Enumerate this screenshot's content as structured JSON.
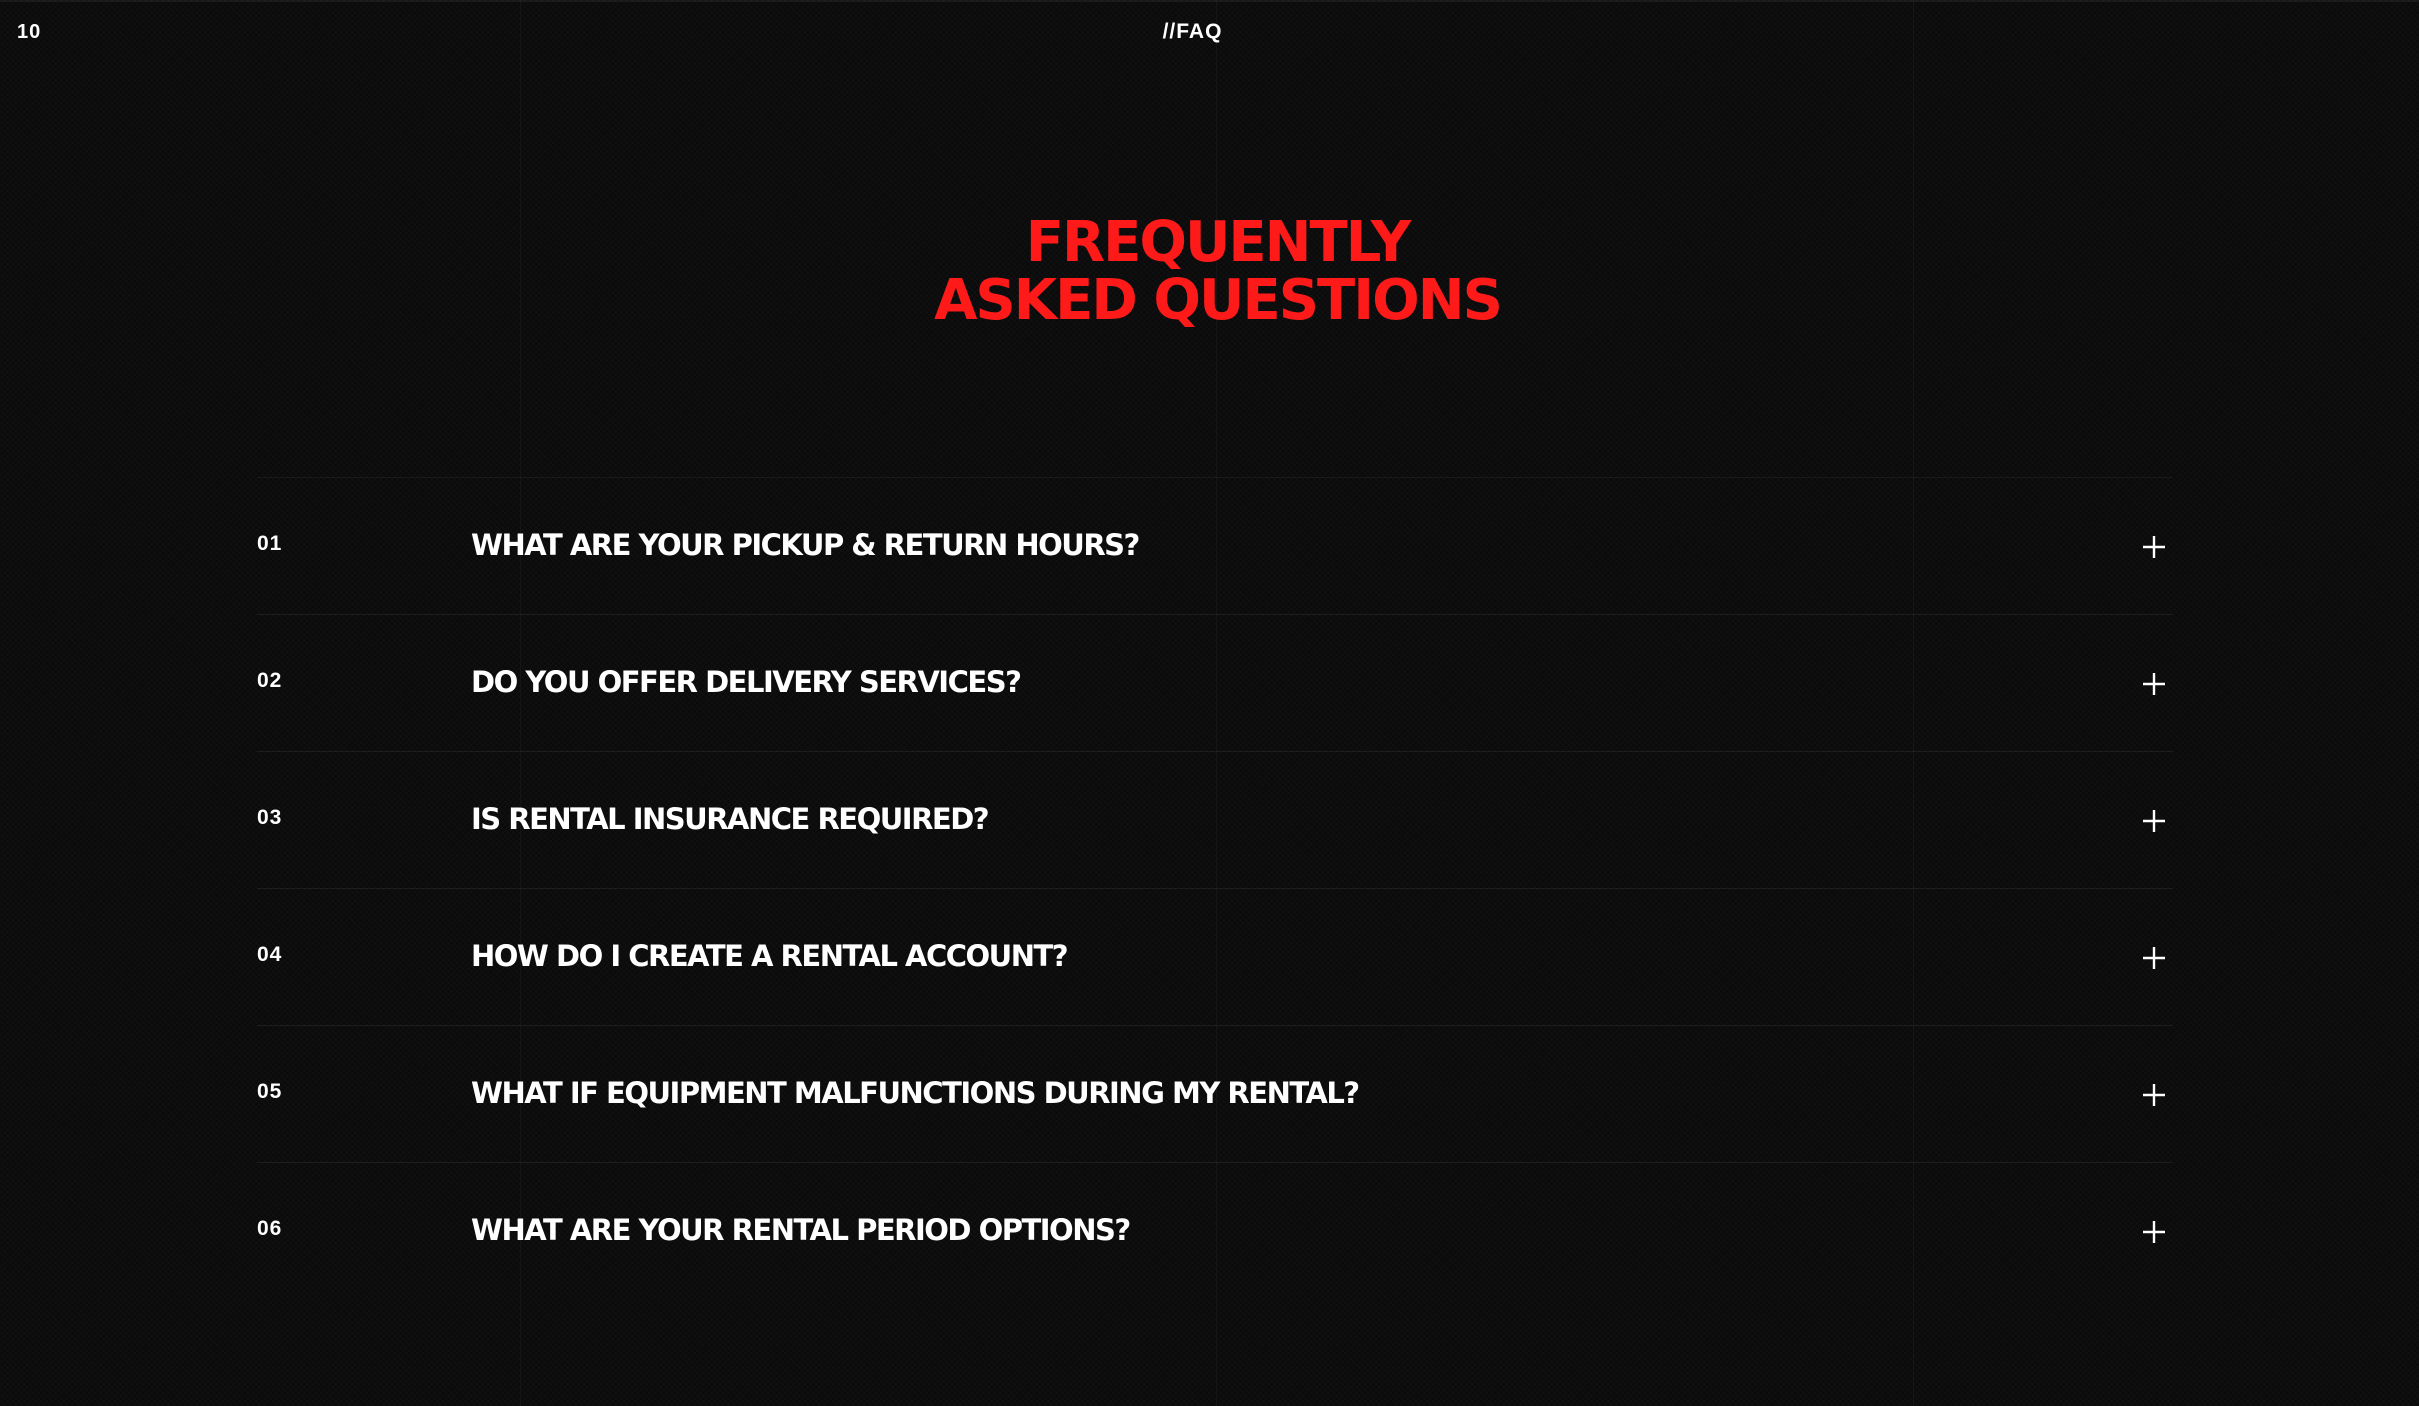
{
  "header": {
    "section_number": "10",
    "section_tag": "//FAQ"
  },
  "title": {
    "line1": "FREQUENTLY",
    "line2": "ASKED QUESTIONS",
    "color": "#ff1a1a"
  },
  "faq": {
    "toggle_icon": "plus-icon",
    "items": [
      {
        "number": "01",
        "question": "WHAT ARE YOUR PICKUP & RETURN HOURS?"
      },
      {
        "number": "02",
        "question": "DO YOU OFFER DELIVERY SERVICES?"
      },
      {
        "number": "03",
        "question": "IS RENTAL INSURANCE REQUIRED?"
      },
      {
        "number": "04",
        "question": "HOW DO I CREATE A RENTAL ACCOUNT?"
      },
      {
        "number": "05",
        "question": "WHAT IF EQUIPMENT MALFUNCTIONS DURING MY RENTAL?"
      },
      {
        "number": "06",
        "question": "WHAT ARE YOUR RENTAL PERIOD OPTIONS?"
      }
    ]
  },
  "colors": {
    "background": "#0b0b0c",
    "text": "#ffffff",
    "accent": "#ff1a1a"
  }
}
